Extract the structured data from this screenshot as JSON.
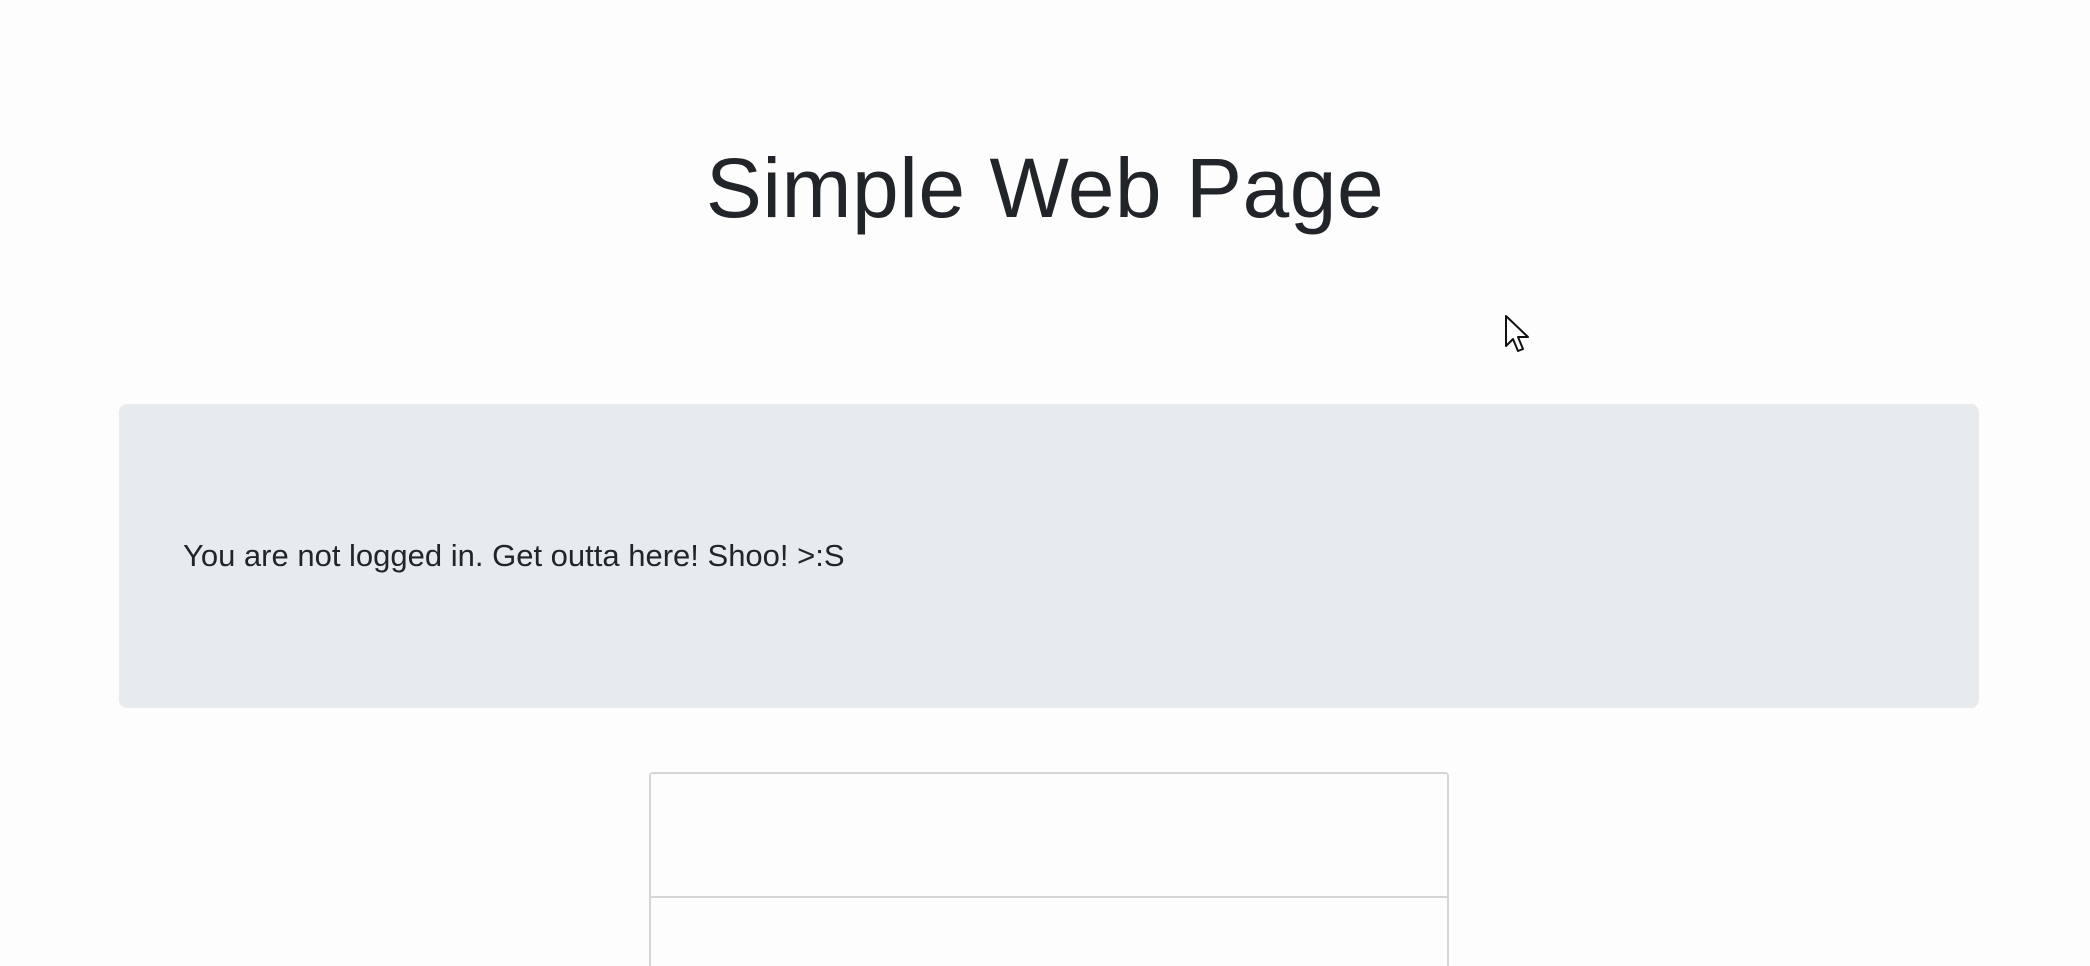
{
  "page": {
    "title": "Simple Web Page"
  },
  "jumbotron": {
    "message": "You are not logged in. Get outta here! Shoo! >:S"
  },
  "login_card": {
    "header_text": "",
    "body_text": ""
  },
  "colors": {
    "background": "#fdfdfd",
    "text": "#212529",
    "jumbotron_bg": "#e8ebee",
    "card_border": "#d5d5d5"
  },
  "icons": {
    "cursor": "mouse-pointer-icon"
  }
}
